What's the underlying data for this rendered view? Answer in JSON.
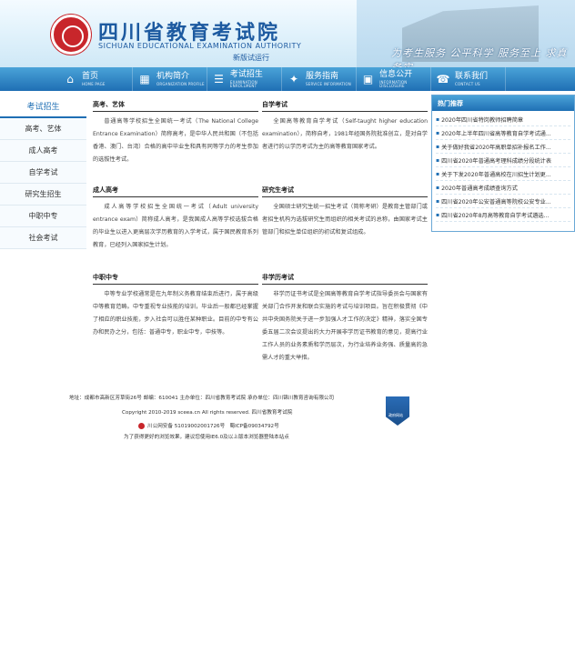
{
  "header": {
    "title": "四川省教育考试院",
    "subtitle": "SICHUAN EDUCATIONAL EXAMINATION AUTHORITY",
    "badge": "新版试运行",
    "slogan": "为考生服务  公平科学  服务至上  求真务实"
  },
  "nav": {
    "items": [
      {
        "cn": "首页",
        "en": "HOME PAGE",
        "icon": "home-icon"
      },
      {
        "cn": "机构简介",
        "en": "ORGANIZATION PROFILE",
        "icon": "org-icon"
      },
      {
        "cn": "考试招生",
        "en": "EXAMINATION ENROLLMENT",
        "icon": "exam-icon"
      },
      {
        "cn": "服务指南",
        "en": "SERVICE INFORMATION",
        "icon": "service-icon"
      },
      {
        "cn": "信息公开",
        "en": "INFORMATION DISCLOSURE",
        "icon": "info-icon"
      },
      {
        "cn": "联系我们",
        "en": "CONTACT US",
        "icon": "contact-icon"
      }
    ]
  },
  "sidebar": {
    "items": [
      {
        "label": "考试招生",
        "active": true
      },
      {
        "label": "高考、艺体"
      },
      {
        "label": "成人高考"
      },
      {
        "label": "自学考试"
      },
      {
        "label": "研究生招生"
      },
      {
        "label": "中职中专"
      },
      {
        "label": "社会考试"
      }
    ]
  },
  "sections": [
    {
      "title": "高考、艺体",
      "body": "普通高等学校招生全国统一考试（The National College Entrance Examination）简称高考，是中华人民共和国（不包括香港、澳门、台湾）合格的高中毕业生和具有同等学力的考生参加的选拔性考试。"
    },
    {
      "title": "自学考试",
      "body": "全国高等教育自学考试（Self-taught higher education examination），简称自考，1981年经国务院批准创立，是对自学者进行的以学历考试为主的高等教育国家考试。"
    },
    {
      "title": "成人高考",
      "body": "成人高等学校招生全国统一考试（Adult university entrance exam）简称成人高考，是我国成人高等学校选拔合格的毕业生以进入更高层次学历教育的入学考试，属于国民教育系列教育，已经列入国家招生计划。"
    },
    {
      "title": "研究生考试",
      "body": "全国硕士研究生统一招生考试（简称考研）是教育主管部门或者招生机构为选拔研究生而组织的相关考试的总称，由国家考试主管部门和招生单位组织的初试和复试组成。"
    },
    {
      "title": "中职中专",
      "body": "中等专业学校通常是在九年制义务教育结束后进行，属于高级中等教育范畴。中专重视专业技能的培训，毕业后一般都已经掌握了相应的职业技能，步入社会可以胜任某种职业。目前的中专有公办和民办之分，包括：普通中专，职业中专，中技等。"
    },
    {
      "title": "非学历考试",
      "body": "非学历证书考试是全国高等教育自学考试指导委员会与国家有关部门合作开发和联合实施的考试与培训项目。旨在积极贯彻《中共中央国务院关于进一步加强人才工作的决定》精神，落实全国专委五届二次会议提出的大力开展非学历证书教育的意见，提高行业工作人员的业务素质和学历层次，为行业培养业务强、质量高的急需人才的重大举措。"
    }
  ],
  "hot": {
    "title": "热门推荐",
    "items": [
      "2020年四川省特岗教师招聘简章",
      "2020年上半年四川省高等教育自学考试通...",
      "关于做好我省2020年高职单招补报名工作...",
      "四川省2020年普通高考理科成绩分段统计表",
      "关于下发2020年普通高校在川招生计划更...",
      "2020年普通高考成绩查询方式",
      "四川省2020年公安普通高等院校公安专业...",
      "四川省2020年8月高等教育自学考试遴选..."
    ]
  },
  "footer": {
    "address": "地址：成都市高新区芳草街26号 邮编：610041 主办单位：四川省教育考试院 承办单位：四川锦川教育咨询有限公司",
    "copyright": "Copyright 2010-2019 sceea.cn All rights reserved. 四川省教育考试院",
    "police": "川公网安备 51019002001726号",
    "icp": "蜀ICP备09034792号",
    "tip": "为了获得更好的浏览效果，建议您使用IE6.0及以上版本浏览器登陆本站点",
    "emblem": "政府网站"
  }
}
